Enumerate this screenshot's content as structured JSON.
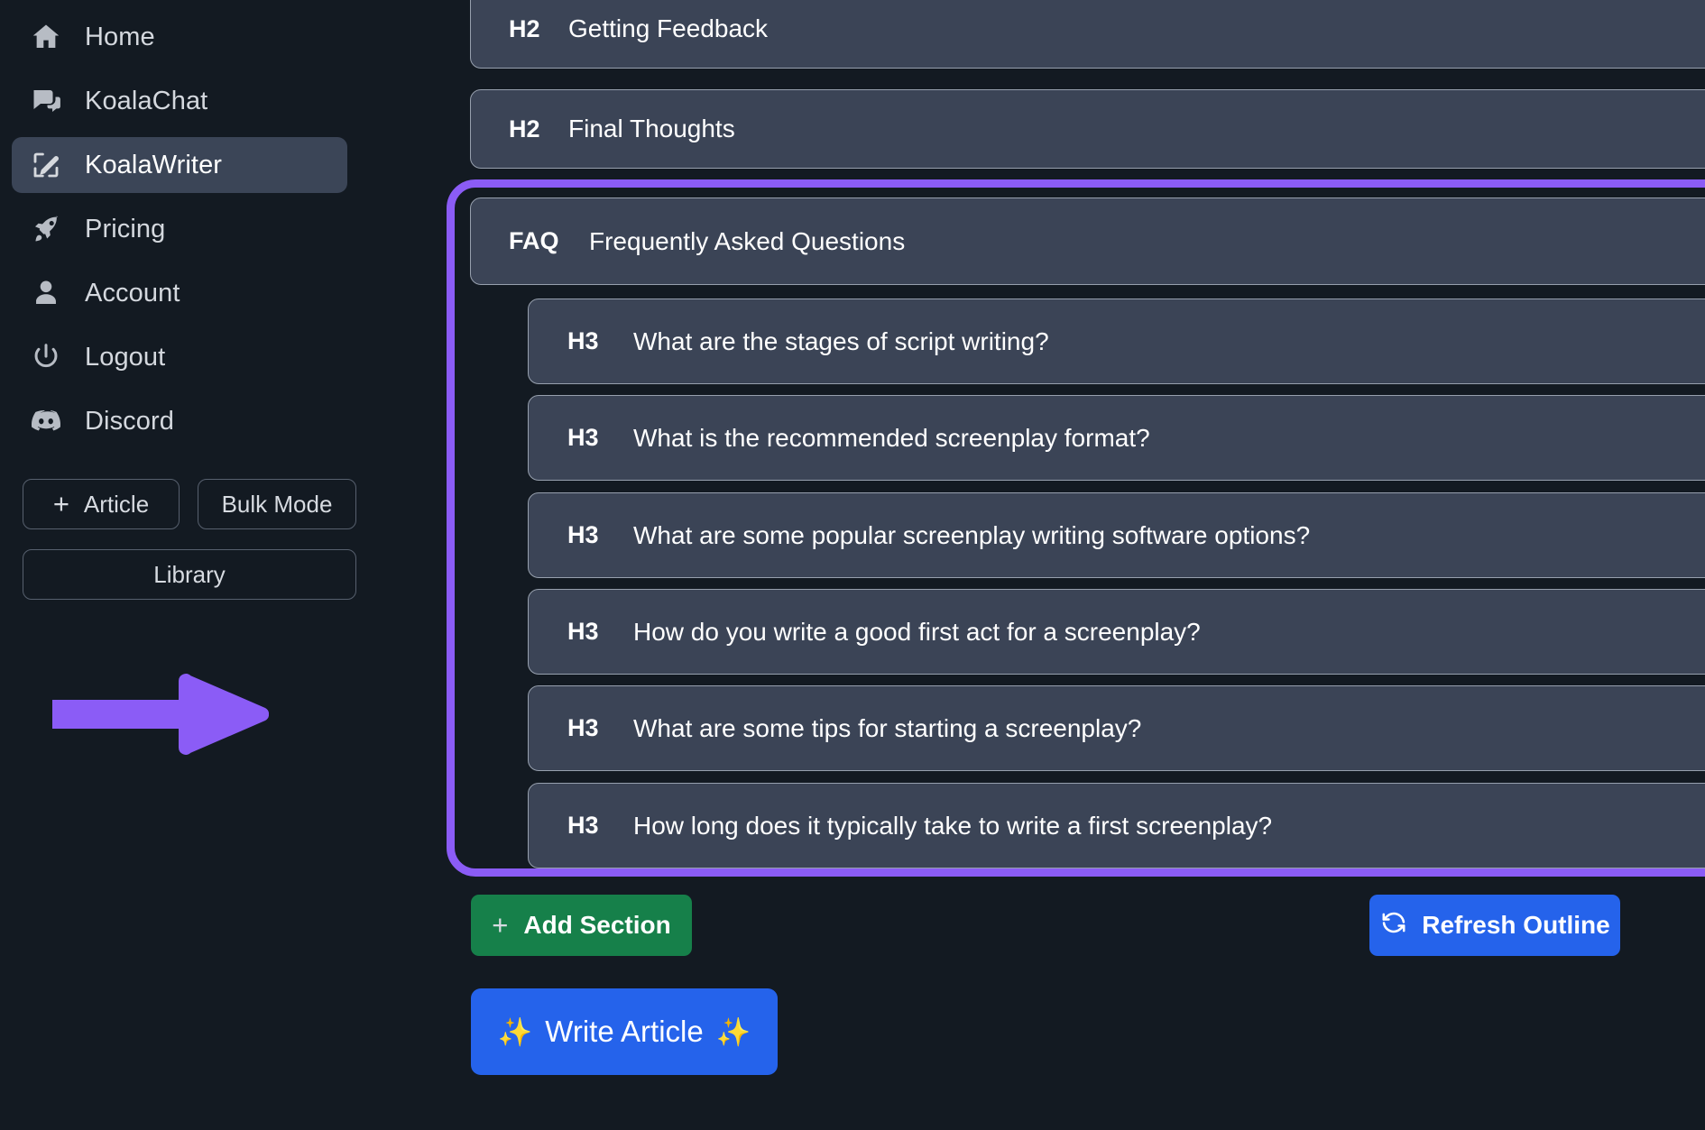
{
  "sidebar": {
    "items": [
      {
        "label": "Home",
        "icon": "home-icon",
        "active": false
      },
      {
        "label": "KoalaChat",
        "icon": "chat-icon",
        "active": false
      },
      {
        "label": "KoalaWriter",
        "icon": "pencil-square-icon",
        "active": true
      },
      {
        "label": "Pricing",
        "icon": "rocket-icon",
        "active": false
      },
      {
        "label": "Account",
        "icon": "user-icon",
        "active": false
      },
      {
        "label": "Logout",
        "icon": "power-icon",
        "active": false
      },
      {
        "label": "Discord",
        "icon": "discord-icon",
        "active": false
      }
    ],
    "buttons": {
      "article": "Article",
      "article_plus": "+",
      "bulk_mode": "Bulk Mode",
      "library": "Library"
    },
    "annotation": {
      "type": "arrow-right",
      "color": "#8b5cf6"
    }
  },
  "outline": {
    "sections": [
      {
        "tag": "H2",
        "title": "Getting Feedback",
        "actions": []
      },
      {
        "tag": "H2",
        "title": "Final Thoughts",
        "actions": [
          "duplicate-icon",
          "edit-icon",
          "close-icon"
        ]
      }
    ],
    "faq_group": {
      "highlighted": true,
      "highlight_color": "#8b5cf6",
      "header": {
        "tag": "FAQ",
        "title": "Frequently Asked Questions"
      },
      "questions": [
        {
          "tag": "H3",
          "title": "What are the stages of script writing?"
        },
        {
          "tag": "H3",
          "title": "What is the recommended screenplay format?"
        },
        {
          "tag": "H3",
          "title": "What are some popular screenplay writing software options?"
        },
        {
          "tag": "H3",
          "title": "How do you write a good first act for a screenplay?"
        },
        {
          "tag": "H3",
          "title": "What are some tips for starting a screenplay?"
        },
        {
          "tag": "H3",
          "title": "How long does it typically take to write a first screenplay?"
        }
      ]
    }
  },
  "actions": {
    "add_section": "Add Section",
    "add_section_plus": "+",
    "refresh_outline": "Refresh Outline",
    "write_article": "Write Article",
    "write_article_sparkle_left": "✨",
    "write_article_sparkle_right": "✨"
  },
  "colors": {
    "background": "#131a22",
    "card": "#3b4456",
    "card_border": "#97a0ae",
    "accent_purple": "#8b5cf6",
    "accent_blue": "#2563eb",
    "accent_green": "#16804a",
    "sidebar_active": "#3b4557"
  }
}
